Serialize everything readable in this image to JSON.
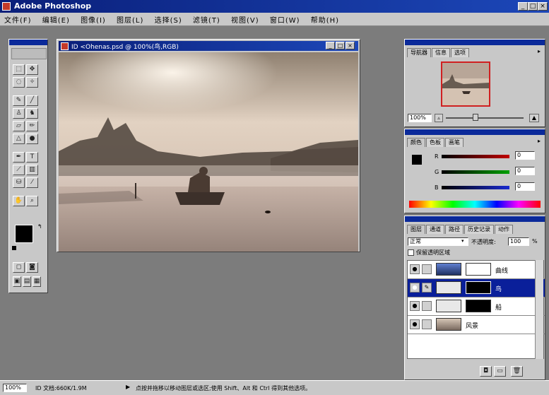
{
  "window": {
    "title": "Adobe Photoshop",
    "minimize": "_",
    "maximize": "□",
    "close": "×"
  },
  "menu": [
    "文件(F)",
    "编辑(E)",
    "图像(I)",
    "图层(L)",
    "选择(S)",
    "滤镜(T)",
    "视图(V)",
    "窗口(W)",
    "帮助(H)"
  ],
  "document": {
    "title": "ID  <Ohenas.psd @ 100%(鸟,RGB)",
    "min": "_",
    "max": "□",
    "close": "×"
  },
  "navigator": {
    "tabs": [
      "导航器",
      "信息",
      "选项"
    ],
    "zoom": "100%"
  },
  "color": {
    "tabs": [
      "颜色",
      "色板",
      "画笔"
    ],
    "r_label": "R",
    "g_label": "G",
    "b_label": "B",
    "r_value": "0",
    "g_value": "0",
    "b_value": "0",
    "r_color": "#c00000",
    "g_color": "#00a000",
    "b_color": "#1a2ad0"
  },
  "layers": {
    "tabs": [
      "图层",
      "通道",
      "路径",
      "历史记录",
      "动作"
    ],
    "blend_mode": "正常",
    "opacity_label": "不透明度:",
    "opacity_value": "100",
    "opacity_unit": "%",
    "preserve_transparency": "保留透明区域",
    "items": [
      {
        "name": "曲线",
        "selected": false
      },
      {
        "name": "鸟",
        "selected": true
      },
      {
        "name": "船",
        "selected": false
      },
      {
        "name": "风景",
        "selected": false
      }
    ]
  },
  "status": {
    "zoom": "100%",
    "doc_size": "ID  文档:660K/1.9M",
    "hint": "点按并拖移以移动图层或选区;使用 Shift、Alt 和 Ctrl 得到其他选项。"
  }
}
